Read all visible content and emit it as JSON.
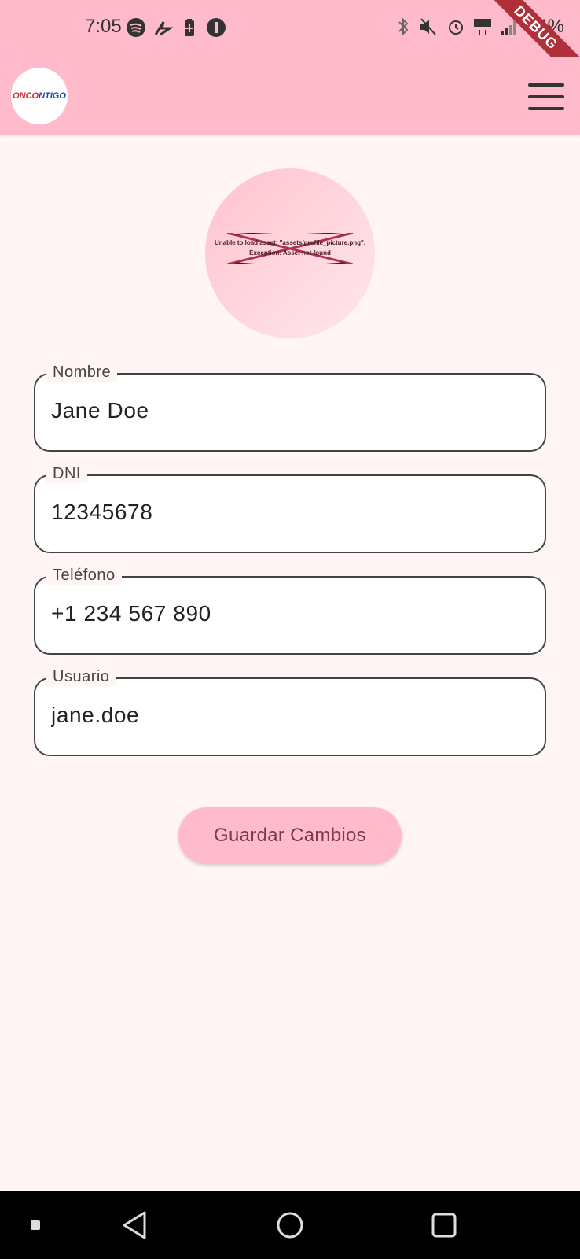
{
  "status_bar": {
    "time": "7:05",
    "battery": "64%",
    "left_icons": [
      "spotify-icon",
      "activity-icon",
      "battery-saver-icon",
      "pocket-icon"
    ],
    "right_icons": [
      "bluetooth-icon",
      "mute-vibrate-icon",
      "alarm-icon",
      "4g-icon",
      "signal-icon"
    ],
    "debug_label": "DEBUG"
  },
  "app_bar": {
    "logo_text_a": "ONCO",
    "logo_text_b": "NTIGO",
    "menu_icon": "hamburger-icon"
  },
  "profile": {
    "image_error_line1": "Unable to load asset: \"assets/profile_picture.png\".",
    "image_error_line2": "Exception: Asset not found"
  },
  "form": {
    "fields": [
      {
        "label": "Nombre",
        "value": "Jane Doe"
      },
      {
        "label": "DNI",
        "value": "12345678"
      },
      {
        "label": "Teléfono",
        "value": "+1 234 567 890"
      },
      {
        "label": "Usuario",
        "value": "jane.doe"
      }
    ],
    "save_label": "Guardar Cambios"
  },
  "colors": {
    "app_bar": "#FFBBCC",
    "background": "#FFF5F5",
    "button": "#FFBBCC",
    "button_text": "#7A3A4E"
  },
  "nav_bar": {
    "icons": [
      "recent-apps-dot-icon",
      "back-icon",
      "home-icon",
      "overview-icon"
    ]
  }
}
